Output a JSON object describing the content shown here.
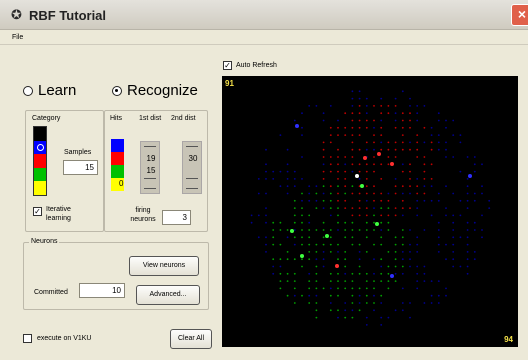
{
  "window": {
    "title": "RBF Tutorial",
    "close": "×"
  },
  "menu": {
    "file": "File"
  },
  "mode": {
    "learn": "Learn",
    "recognize": "Recognize",
    "selected": "recognize"
  },
  "category": {
    "label": "Category",
    "colors": [
      "#000000",
      "#0000ff",
      "#ff0000",
      "#00c000",
      "#ffff00"
    ],
    "selected_index": 1
  },
  "samples": {
    "label": "Samples",
    "value": "15"
  },
  "iterative": {
    "label": "Iterative learning",
    "checked": true
  },
  "hits": {
    "label": "Hits",
    "colors": [
      "#0000ff",
      "#ff0000",
      "#00c000",
      "#ffff00"
    ],
    "value": "0"
  },
  "dist1": {
    "label": "1st dist",
    "values": [
      "19",
      "15"
    ]
  },
  "dist2": {
    "label": "2nd dist",
    "values": [
      "30"
    ]
  },
  "firing": {
    "label": "firing neurons",
    "value": "3"
  },
  "neurons": {
    "group_label": "Neurons",
    "committed_label": "Committed",
    "committed_value": "10",
    "view_button": "View neurons",
    "advanced_button": "Advanced..."
  },
  "execute": {
    "label": "execute on V1KU",
    "checked": false
  },
  "clear_button": "Clear All",
  "auto_refresh": {
    "label": "Auto Refresh",
    "checked": true
  },
  "display": {
    "top_left": "91",
    "bottom_right": "94"
  },
  "colors": {
    "background": "#ece9d8",
    "display": "#000000",
    "corner_text": "#f5e24a"
  }
}
